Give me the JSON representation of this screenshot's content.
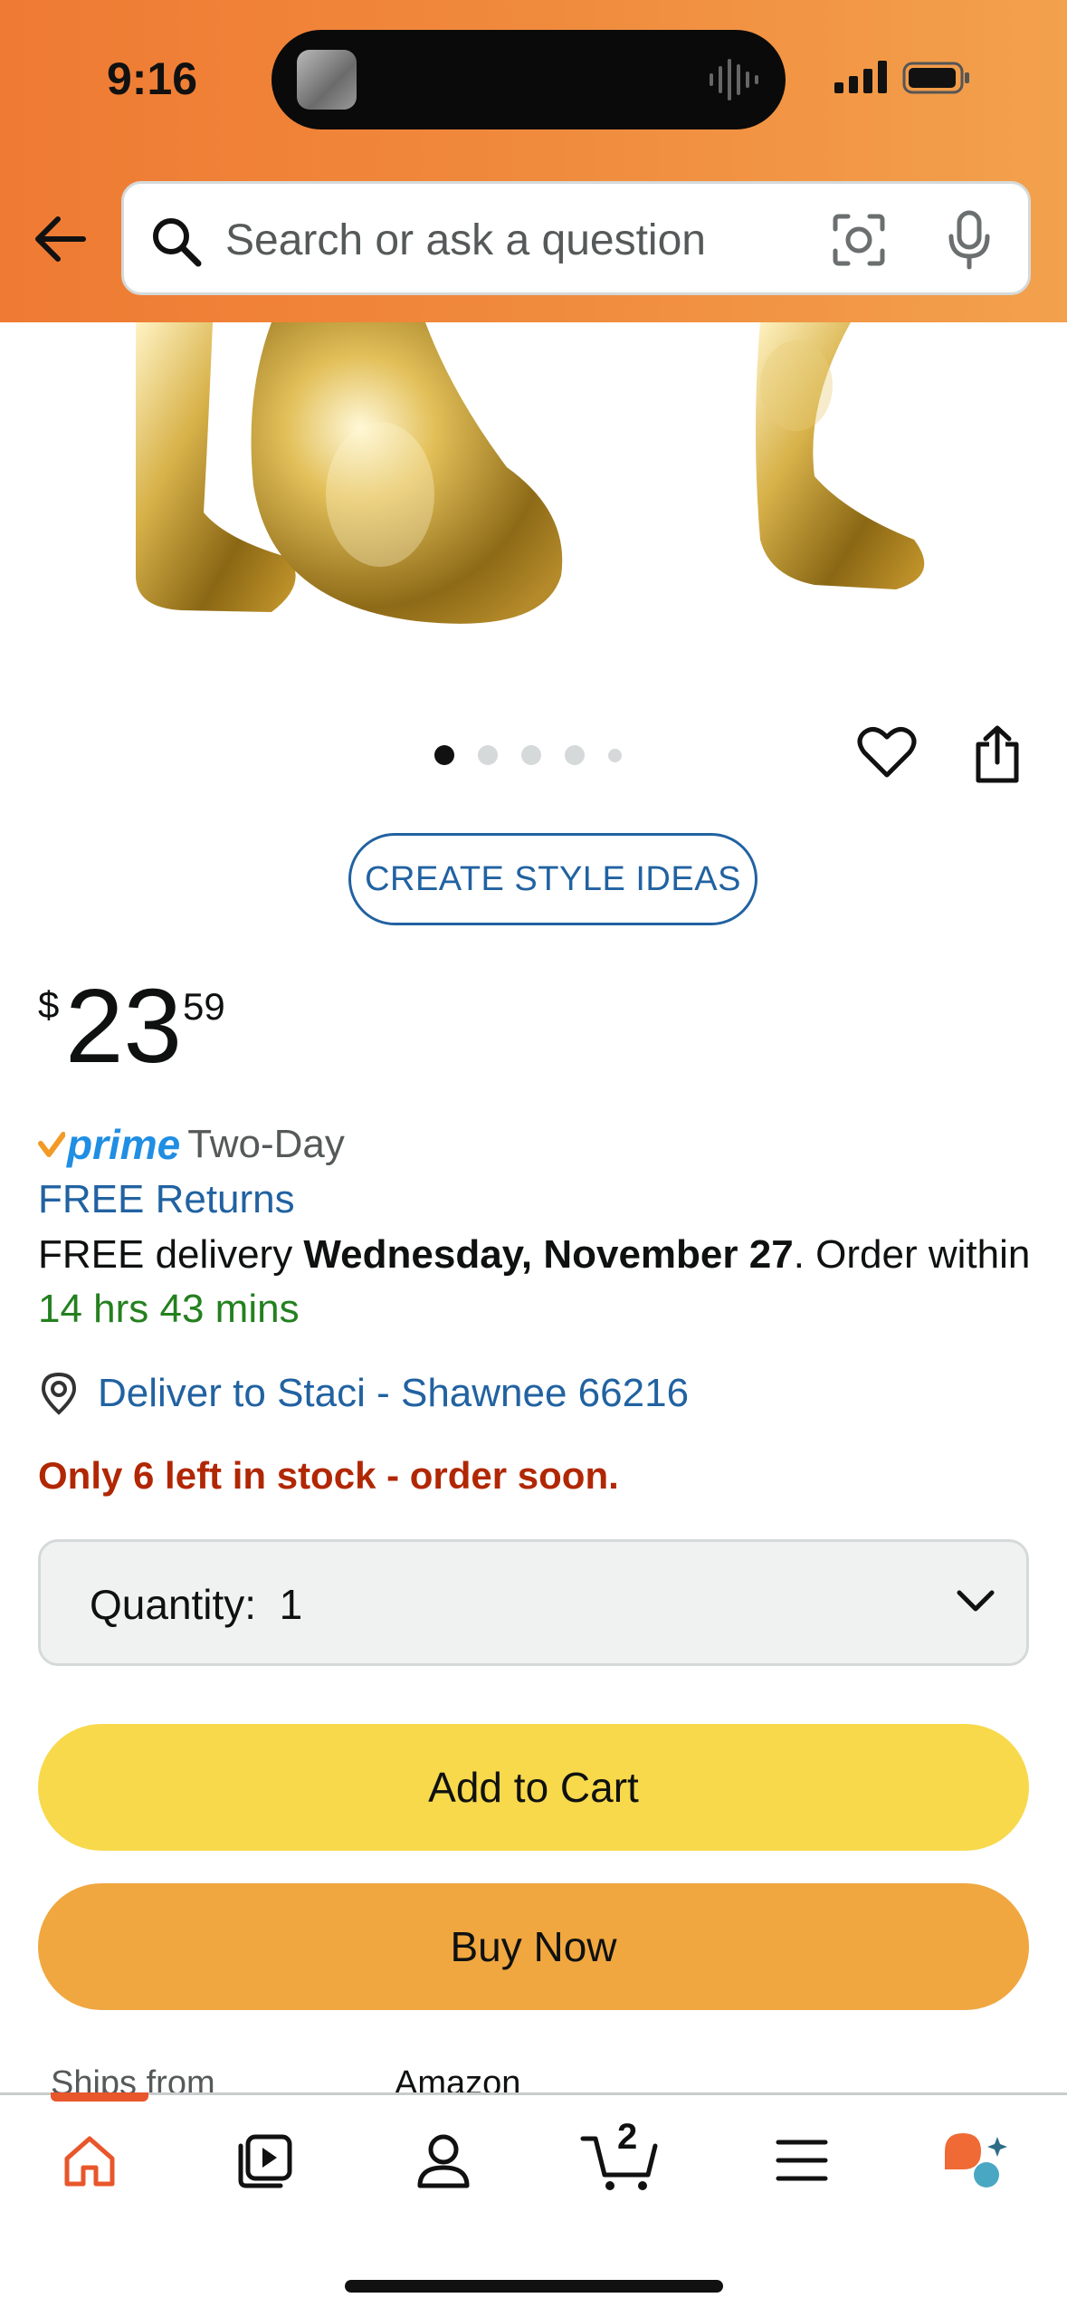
{
  "status_bar": {
    "time": "9:16"
  },
  "search": {
    "placeholder": "Search or ask a question"
  },
  "product": {
    "image_dots": {
      "count": 5,
      "active_index": 0
    },
    "create_style_ideas": "CREATE STYLE IDEAS",
    "price": {
      "symbol": "$",
      "whole": "23",
      "fraction": "59"
    },
    "prime": {
      "word": "prime",
      "label": "Two-Day"
    },
    "free_returns": "FREE Returns",
    "delivery": {
      "prefix": "FREE delivery ",
      "date": "Wednesday, November 27",
      "suffix": ". Order within ",
      "countdown": "14 hrs 43 mins"
    },
    "deliver_to": "Deliver to Staci - Shawnee 66216",
    "stock_message": "Only 6 left in stock - order soon.",
    "quantity": {
      "label": "Quantity:",
      "value": "1"
    },
    "add_to_cart": "Add to Cart",
    "buy_now": "Buy Now",
    "ships_from": {
      "label": "Ships from",
      "value": "Amazon"
    }
  },
  "bottom_nav": {
    "cart_count": "2",
    "items": [
      "home",
      "video",
      "account",
      "cart",
      "menu",
      "rufus"
    ],
    "active": "home"
  },
  "colors": {
    "header_start": "#ef7a33",
    "header_end": "#f3a14d",
    "link": "#2162a1",
    "add_to_cart": "#f7d94b",
    "buy_now": "#f0a73f",
    "stock_red": "#b12704",
    "countdown_green": "#24801f",
    "prime_blue": "#1f8ee3"
  }
}
